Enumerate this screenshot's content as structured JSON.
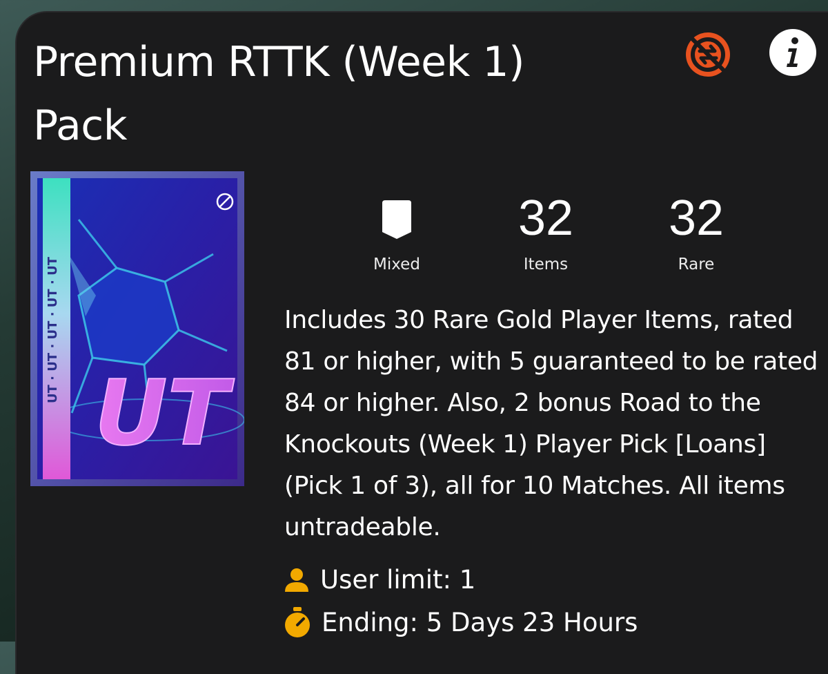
{
  "pack": {
    "title": "Premium RTTK (Week 1) Pack",
    "art_text": "UT",
    "art_side_text": "UT · UT · UT · UT · UT",
    "stats": [
      {
        "value": "",
        "label": "Mixed",
        "icon": "shield-icon"
      },
      {
        "value": "32",
        "label": "Items"
      },
      {
        "value": "32",
        "label": "Rare"
      }
    ],
    "description": "Includes 30 Rare Gold Player Items, rated 81 or higher, with 5 guaranteed to be rated 84 or higher. Also, 2 bonus Road to the Knockouts (Week 1) Player Pick [Loans] (Pick 1 of 3), all for 10 Matches. All items untradeable.",
    "user_limit": "User limit: 1",
    "ending": "Ending: 5 Days 23 Hours"
  },
  "icons": {
    "untradeable": "no-transfer-icon",
    "info": "info-icon",
    "user": "user-icon",
    "timer": "stopwatch-icon"
  },
  "colors": {
    "card_bg": "#1b1b1c",
    "untradeable_accent": "#e8521f",
    "meta_icon": "#f2a900",
    "text": "#ffffff"
  }
}
